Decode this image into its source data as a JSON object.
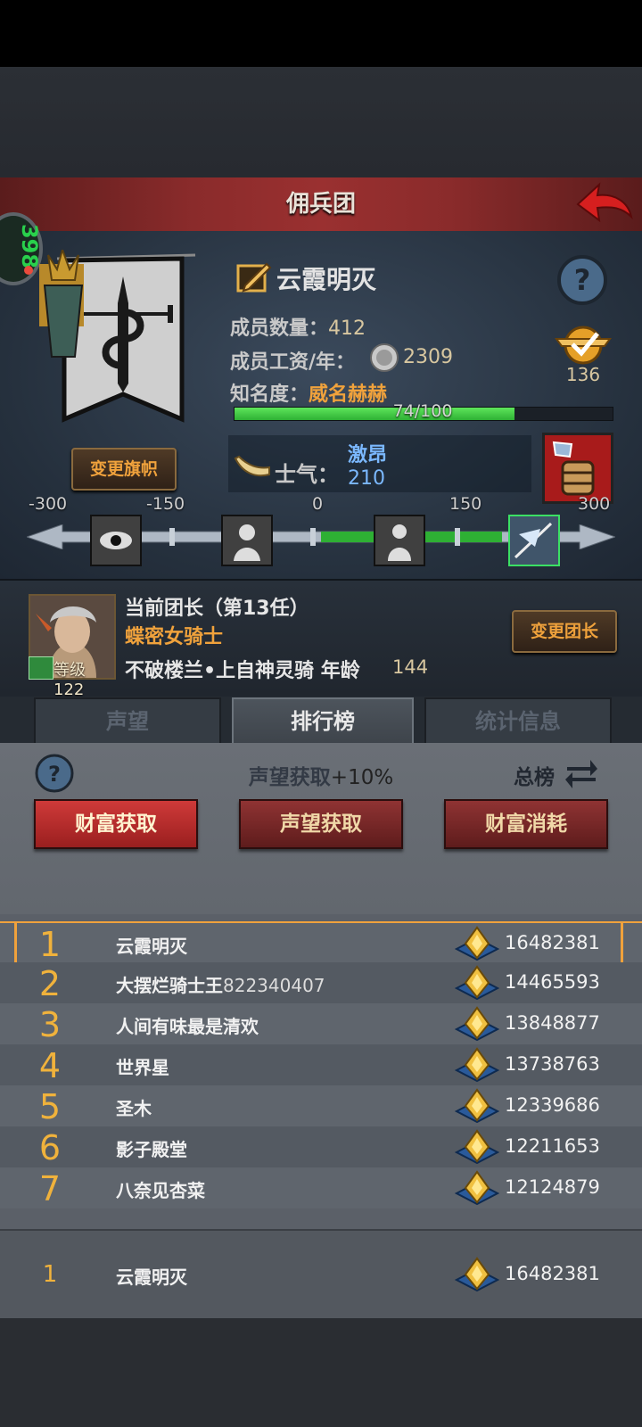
{
  "header": {
    "title": "佣兵团"
  },
  "side_badge": {
    "text": "398"
  },
  "guild": {
    "name": "云霞明灭",
    "members_label": "成员数量：",
    "members": "412",
    "salary_label": "成员工资/年：",
    "salary": "2309",
    "fame_label": "知名度：",
    "fame_value": "威名赫赫",
    "fame_progress": "74/100",
    "fame_ratio": 0.74,
    "shield_value": "136",
    "change_flag": "变更旗帜"
  },
  "morale": {
    "label": "士气：",
    "state": "激昂",
    "value": "210",
    "scale_ticks": [
      "-300",
      "-150",
      "0",
      "150",
      "300"
    ],
    "value_num": 210,
    "min": -300,
    "max": 300
  },
  "leader": {
    "title": "当前团长（第13任）",
    "name": "蝶密女骑士",
    "info": "不破楼兰•上自神灵骑 年龄",
    "age": "144",
    "level": "等级122",
    "change_btn": "变更团长"
  },
  "tabs": [
    "声望",
    "排行榜",
    "统计信息"
  ],
  "ranking": {
    "bonus_label": "声望获取",
    "bonus_pct": "+10%",
    "total_label": "总榜",
    "buttons": [
      "财富获取",
      "声望获取",
      "财富消耗"
    ],
    "rows": [
      {
        "rank": "1",
        "name": "云霞明灭",
        "num": "",
        "score": "16482381"
      },
      {
        "rank": "2",
        "name": "大摆烂骑士王",
        "num": "822340407",
        "score": "14465593"
      },
      {
        "rank": "3",
        "name": "人间有味最是清欢",
        "num": "",
        "score": "13848877"
      },
      {
        "rank": "4",
        "name": "世界星",
        "num": "",
        "score": "13738763"
      },
      {
        "rank": "5",
        "name": "圣木",
        "num": "",
        "score": "12339686"
      },
      {
        "rank": "6",
        "name": "影子殿堂",
        "num": "",
        "score": "12211653"
      },
      {
        "rank": "7",
        "name": "八奈见杏菜",
        "num": "",
        "score": "12124879"
      }
    ],
    "my_row": {
      "rank": "1",
      "name": "云霞明灭",
      "score": "16482381"
    }
  },
  "colors": {
    "accent": "#f0a23c",
    "active_green": "#2eb034",
    "title_red": "#8a2b2b"
  }
}
